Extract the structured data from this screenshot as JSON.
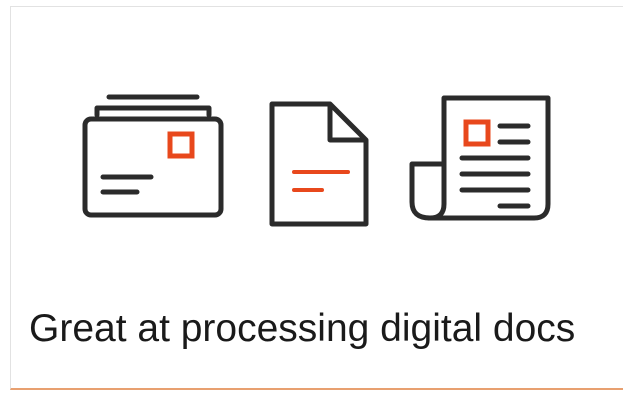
{
  "caption": "Great at processing digital docs",
  "icons": [
    {
      "name": "mail-stack-icon"
    },
    {
      "name": "document-icon"
    },
    {
      "name": "newspaper-icon"
    }
  ],
  "colors": {
    "stroke": "#2b2b2b",
    "accent": "#e8481c"
  }
}
